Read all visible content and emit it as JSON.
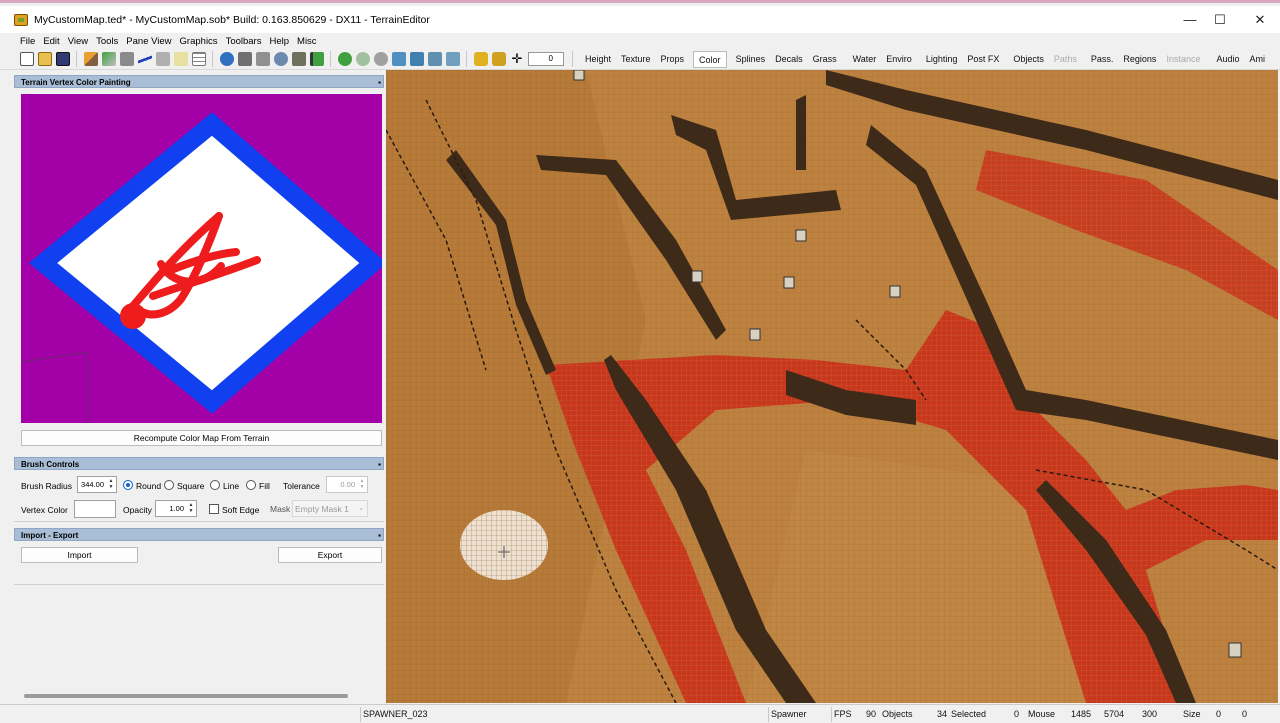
{
  "window": {
    "title": "MyCustomMap.ted* - MyCustomMap.sob* Build: 0.163.850629 - DX11 - TerrainEditor",
    "minimize": "—",
    "maximize": "☐",
    "close": "✕"
  },
  "menu": [
    "File",
    "Edit",
    "View",
    "Tools",
    "Pane View",
    "Graphics",
    "Toolbars",
    "Help",
    "Misc"
  ],
  "toolbar": {
    "spin_value": "0",
    "tabs": [
      {
        "label": "Height",
        "state": "normal"
      },
      {
        "label": "Texture",
        "state": "normal"
      },
      {
        "label": "Props",
        "state": "normal"
      },
      {
        "label": "Color",
        "state": "active"
      },
      {
        "label": "Splines",
        "state": "normal"
      },
      {
        "label": "Decals",
        "state": "normal"
      },
      {
        "label": "Grass",
        "state": "normal"
      },
      {
        "label": "Water",
        "state": "normal"
      },
      {
        "label": "Enviro",
        "state": "normal"
      },
      {
        "label": "Lighting",
        "state": "normal"
      },
      {
        "label": "Post FX",
        "state": "normal"
      },
      {
        "label": "Objects",
        "state": "normal"
      },
      {
        "label": "Paths",
        "state": "disabled"
      },
      {
        "label": "Pass.",
        "state": "normal"
      },
      {
        "label": "Regions",
        "state": "normal"
      },
      {
        "label": "Instance",
        "state": "disabled"
      },
      {
        "label": "Audio",
        "state": "normal"
      },
      {
        "label": "Ami",
        "state": "normal"
      }
    ]
  },
  "vertex_color_panel": {
    "title": "Terrain Vertex Color Painting",
    "recompute_label": "Recompute Color Map From Terrain",
    "colors": {
      "background": "#a400a8",
      "border": "#1040f0",
      "fill": "#ffffff",
      "paint": "#ee1c1c"
    }
  },
  "brush_controls": {
    "title": "Brush Controls",
    "radius_label": "Brush Radius",
    "radius_value": "344.00",
    "shapes": [
      {
        "label": "Round",
        "selected": true
      },
      {
        "label": "Square",
        "selected": false
      },
      {
        "label": "Line",
        "selected": false
      },
      {
        "label": "Fill",
        "selected": false
      }
    ],
    "tolerance_label": "Tolerance",
    "tolerance_value": "0.00",
    "vertex_color_label": "Vertex Color",
    "opacity_label": "Opacity",
    "opacity_value": "1.00",
    "soft_edge_label": "Soft Edge",
    "mask_label": "Mask",
    "mask_value": "Empty Mask 1"
  },
  "import_export": {
    "title": "Import - Export",
    "import_label": "Import",
    "export_label": "Export"
  },
  "status": {
    "selected_object": "SPAWNER_023",
    "mode": "Spawner",
    "fps_label": "FPS",
    "objects_count": "90",
    "objects_label": "Objects",
    "selected_count": "34",
    "selected_label": "Selected",
    "mouse_value": "0",
    "mouse_label": "Mouse",
    "mouse_x": "1485",
    "mouse_y": "5704",
    "mouse_z": "300",
    "size_label": "Size",
    "size_x": "0",
    "size_y": "0"
  }
}
